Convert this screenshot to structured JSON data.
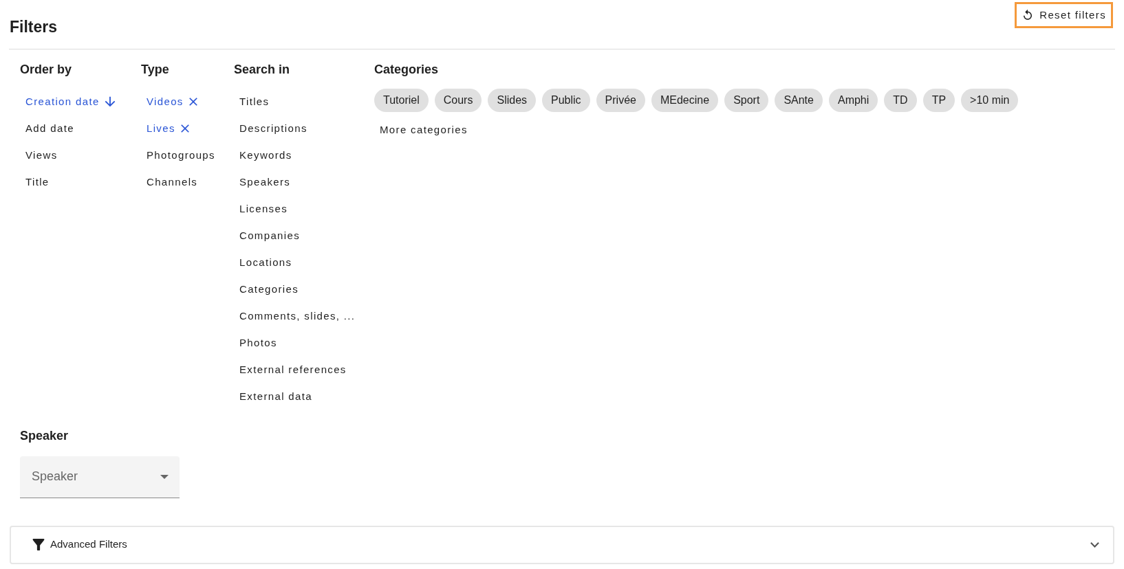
{
  "title": "Filters",
  "reset_button": {
    "label": "Reset filters",
    "focused": true
  },
  "order_by": {
    "heading": "Order by",
    "items": [
      {
        "label": "Creation date",
        "selected": true
      },
      {
        "label": "Add date",
        "selected": false
      },
      {
        "label": "Views",
        "selected": false
      },
      {
        "label": "Title",
        "selected": false
      }
    ]
  },
  "type": {
    "heading": "Type",
    "items": [
      {
        "label": "Videos",
        "selected": true
      },
      {
        "label": "Lives",
        "selected": true
      },
      {
        "label": "Photogroups",
        "selected": false
      },
      {
        "label": "Channels",
        "selected": false
      }
    ]
  },
  "search_in": {
    "heading": "Search in",
    "items": [
      "Titles",
      "Descriptions",
      "Keywords",
      "Speakers",
      "Licenses",
      "Companies",
      "Locations",
      "Categories",
      "Comments, slides, ...",
      "Photos",
      "External references",
      "External data"
    ]
  },
  "categories": {
    "heading": "Categories",
    "chips": [
      "Tutoriel",
      "Cours",
      "Slides",
      "Public",
      "Privée",
      "MEdecine",
      "Sport",
      "SAnte",
      "Amphi",
      "TD",
      "TP",
      ">10 min"
    ],
    "more": "More categories"
  },
  "speaker": {
    "heading": "Speaker",
    "select": {
      "placeholder": "Speaker"
    }
  },
  "advanced": {
    "label": "Advanced Filters",
    "expanded": false
  }
}
